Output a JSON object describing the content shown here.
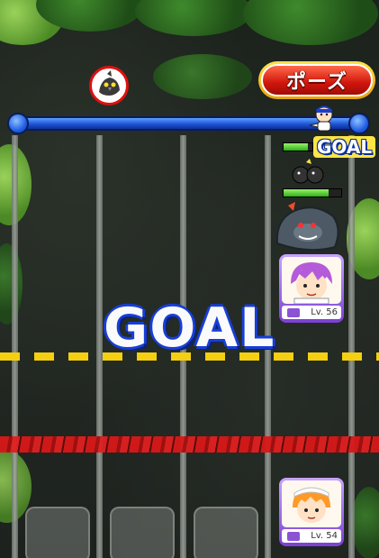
{
  "hud": {
    "pause_label": "ポーズ",
    "goal_badge": "GOAL"
  },
  "field": {
    "goal_banner": "GOAL"
  },
  "players": [
    {
      "level_label": "Lv. 56"
    },
    {
      "level_label": "Lv. 54"
    }
  ],
  "gauges": [
    {
      "name": "hp-gauge-top",
      "value": 0.85
    },
    {
      "name": "hp-gauge-second",
      "value": 0.78
    }
  ],
  "colors": {
    "goal_blue": "#173ed8",
    "pause_red": "#d0150c",
    "progress_blue": "#1d55d8",
    "start_line_yellow": "#f4cf12",
    "red_line": "#d81818"
  },
  "icons": {
    "enemy_marker": "crow-enemy-icon",
    "runner": "runner-player-icon",
    "boss": "gorilla-boss-icon",
    "bomb": "bomb-enemy-icon"
  }
}
